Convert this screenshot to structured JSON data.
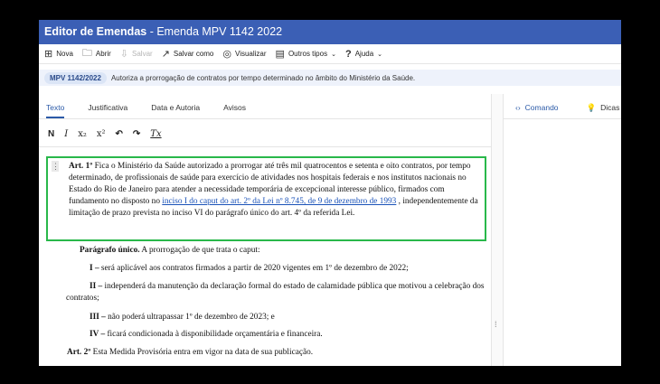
{
  "window": {
    "title_bold": "Editor de Emendas",
    "title_rest": " - Emenda MPV 1142 2022"
  },
  "toolbar": {
    "nova": "Nova",
    "abrir": "Abrir",
    "salvar": "Salvar",
    "salvar_como": "Salvar como",
    "visualizar": "Visualizar",
    "outros_tipos": "Outros tipos",
    "ajuda": "Ajuda"
  },
  "info": {
    "badge": "MPV 1142/2022",
    "ementa": "Autoriza a prorrogação de contratos por tempo determinado no âmbito do Ministério da Saúde."
  },
  "tabs": [
    "Texto",
    "Justificativa",
    "Data e Autoria",
    "Avisos"
  ],
  "format_buttons": [
    "N",
    "I",
    "x₂",
    "x²",
    "↶",
    "↷",
    "Tx"
  ],
  "right_tabs": {
    "comando": "Comando",
    "dicas": "Dicas"
  },
  "document": {
    "art1_label": "Art. 1º",
    "art1_text": " Fica o Ministério da Saúde autorizado a prorrogar até três mil quatrocentos e setenta e oito contratos, por tempo determinado, de profissionais de saúde para exercício de atividades nos hospitais federais e nos institutos nacionais no Estado do Rio de Janeiro para atender a necessidade temporária de excepcional interesse público, firmados com fundamento no disposto no ",
    "art1_link": "inciso I do caput do art. 2º da Lei nº 8.745, de 9 de dezembro de 1993",
    "art1_tail": " , independentemente da limitação de prazo prevista no inciso VI do parágrafo único do art. 4º da referida Lei.",
    "paragrafo_label": "Parágrafo único.",
    "paragrafo_text": "  A prorrogação de que trata o caput:",
    "incisos": [
      {
        "label": "I –",
        "text": "  será aplicável aos contratos firmados a partir de 2020 vigentes em 1º de dezembro de 2022;"
      },
      {
        "label": "II –",
        "text": "  independerá da manutenção da declaração formal do estado de calamidade pública que motivou a celebração dos contratos;"
      },
      {
        "label": "III –",
        "text": "  não poderá ultrapassar 1º de dezembro de 2023; e"
      },
      {
        "label": "IV –",
        "text": "  ficará condicionada à disponibilidade orçamentária e financeira."
      }
    ],
    "art2_label": "Art. 2º",
    "art2_text": "  Esta Medida Provisória entra em vigor na data de sua publicação."
  }
}
